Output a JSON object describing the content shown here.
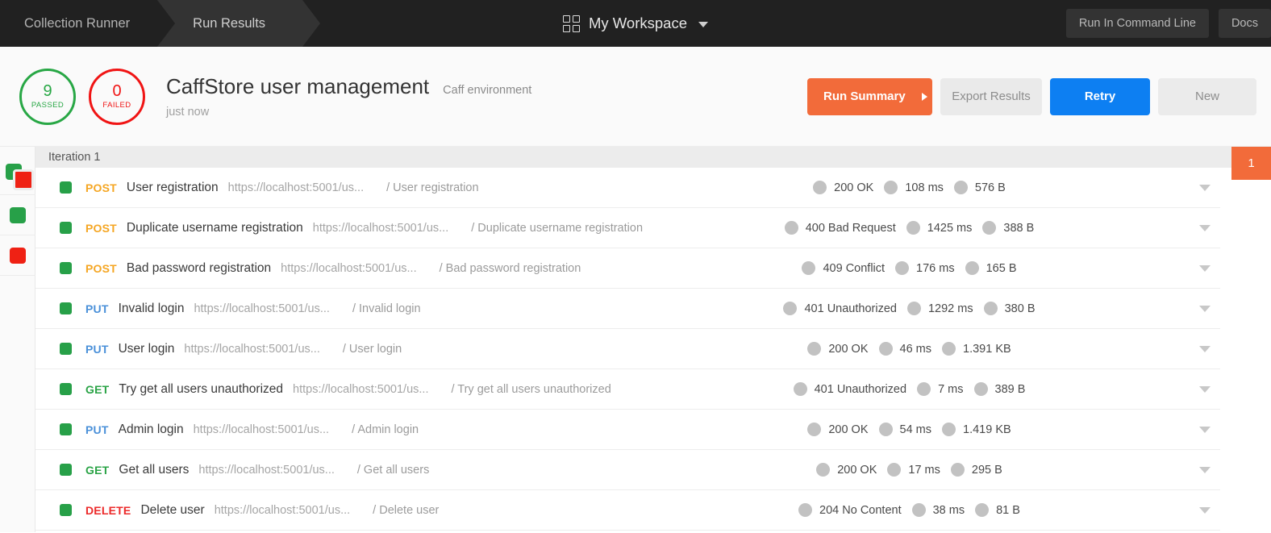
{
  "header": {
    "breadcrumbs": [
      {
        "label": "Collection Runner",
        "active": false
      },
      {
        "label": "Run Results",
        "active": true
      }
    ],
    "workspace": {
      "label": "My Workspace",
      "icon": "grid-icon",
      "caret": "chevron-down-icon"
    },
    "actions": [
      {
        "label": "Run In Command Line"
      },
      {
        "label": "Docs"
      }
    ],
    "bg_color": "#212121",
    "active_tab_color": "#333333"
  },
  "summary": {
    "passed": {
      "count": "9",
      "label": "PASSED",
      "color": "#28a745"
    },
    "failed": {
      "count": "0",
      "label": "FAILED",
      "color": "#f01414"
    },
    "title": "CaffStore user management",
    "environment": "Caff environment",
    "time": "just now",
    "buttons": {
      "run_summary": "Run Summary",
      "export_results": "Export Results",
      "retry": "Retry",
      "new": "New"
    },
    "colors": {
      "orange": "#f26b3a",
      "blue": "#0d7ff2",
      "grey": "#eaeaea"
    }
  },
  "filters": [
    {
      "name": "all-results-filter",
      "icon": "stacked-squares-icon"
    },
    {
      "name": "passed-filter",
      "icon": "green-square-icon"
    },
    {
      "name": "failed-filter",
      "icon": "red-square-icon"
    }
  ],
  "iteration": {
    "label": "Iteration 1",
    "tab_badge": "1",
    "tab_color": "#f26b3a"
  },
  "rows": [
    {
      "status": "passed",
      "method": "POST",
      "method_class": "post",
      "name": "User registration",
      "url": "https://localhost:5001/us...",
      "test": "/ User registration",
      "code": "200 OK",
      "time": "108 ms",
      "size": "576 B"
    },
    {
      "status": "passed",
      "method": "POST",
      "method_class": "post",
      "name": "Duplicate username registration",
      "url": "https://localhost:5001/us...",
      "test": "/ Duplicate username registration",
      "code": "400 Bad Request",
      "time": "1425 ms",
      "size": "388 B"
    },
    {
      "status": "passed",
      "method": "POST",
      "method_class": "post",
      "name": "Bad password registration",
      "url": "https://localhost:5001/us...",
      "test": "/ Bad password registration",
      "code": "409 Conflict",
      "time": "176 ms",
      "size": "165 B"
    },
    {
      "status": "passed",
      "method": "PUT",
      "method_class": "put",
      "name": "Invalid login",
      "url": "https://localhost:5001/us...",
      "test": "/ Invalid login",
      "code": "401 Unauthorized",
      "time": "1292 ms",
      "size": "380 B"
    },
    {
      "status": "passed",
      "method": "PUT",
      "method_class": "put",
      "name": "User login",
      "url": "https://localhost:5001/us...",
      "test": "/ User login",
      "code": "200 OK",
      "time": "46 ms",
      "size": "1.391 KB"
    },
    {
      "status": "passed",
      "method": "GET",
      "method_class": "get",
      "name": "Try get all users unauthorized",
      "url": "https://localhost:5001/us...",
      "test": "/ Try get all users unauthorized",
      "code": "401 Unauthorized",
      "time": "7 ms",
      "size": "389 B"
    },
    {
      "status": "passed",
      "method": "PUT",
      "method_class": "put",
      "name": "Admin login",
      "url": "https://localhost:5001/us...",
      "test": "/ Admin login",
      "code": "200 OK",
      "time": "54 ms",
      "size": "1.419 KB"
    },
    {
      "status": "passed",
      "method": "GET",
      "method_class": "get",
      "name": "Get all users",
      "url": "https://localhost:5001/us...",
      "test": "/ Get all users",
      "code": "200 OK",
      "time": "17 ms",
      "size": "295 B"
    },
    {
      "status": "passed",
      "method": "DELETE",
      "method_class": "delete",
      "name": "Delete user",
      "url": "https://localhost:5001/us...",
      "test": "/ Delete user",
      "code": "204 No Content",
      "time": "38 ms",
      "size": "81 B"
    }
  ]
}
